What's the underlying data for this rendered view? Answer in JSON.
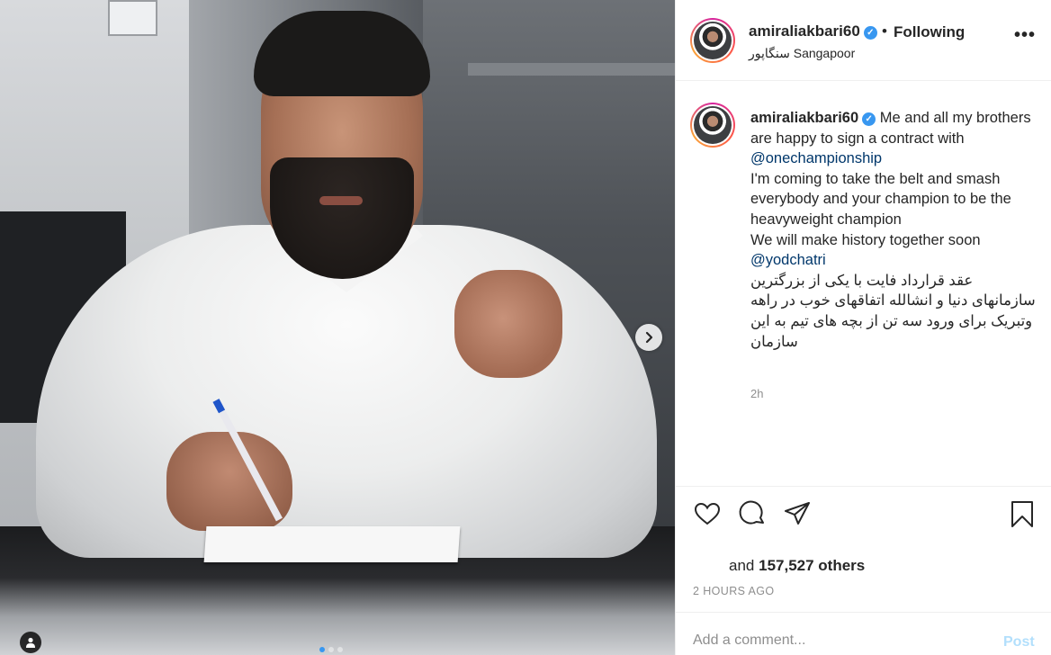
{
  "post": {
    "username": "amiraliakbari60",
    "verified": true,
    "follow_status": "Following",
    "location": "سنگاپور Sangapoor",
    "more_icon": "more-options-icon"
  },
  "caption": {
    "username": "amiraliakbari60",
    "line1": "Me and all my brothers are happy to sign a contract with",
    "mention1": "@onechampionship",
    "line2": "I'm coming to take the belt and smash everybody and your champion to be the heavyweight champion",
    "line3": "We will make history together soon",
    "mention2": "@yodchatri",
    "persian1": "عقد قرارداد فایت با یکی از بزرگترین سازمانهای دنیا و انشالله اتفاقهای خوب در راهه",
    "persian2": "وتبریک برای ورود سه تن از بچه های تیم به این سازمان",
    "time": "2h"
  },
  "actions": {
    "like_icon": "heart-icon",
    "comment_icon": "comment-icon",
    "share_icon": "share-icon",
    "save_icon": "bookmark-icon"
  },
  "likes": {
    "prefix": "and",
    "count": "157,527 others"
  },
  "posted_ago": "2 HOURS AGO",
  "comment": {
    "placeholder": "Add a comment...",
    "post_label": "Post"
  },
  "carousel": {
    "current": 1,
    "total": 3
  },
  "colors": {
    "accent": "#3897f0",
    "mention": "#00376b",
    "muted": "#8e8e8e",
    "post_disabled": "#b2dffc"
  }
}
